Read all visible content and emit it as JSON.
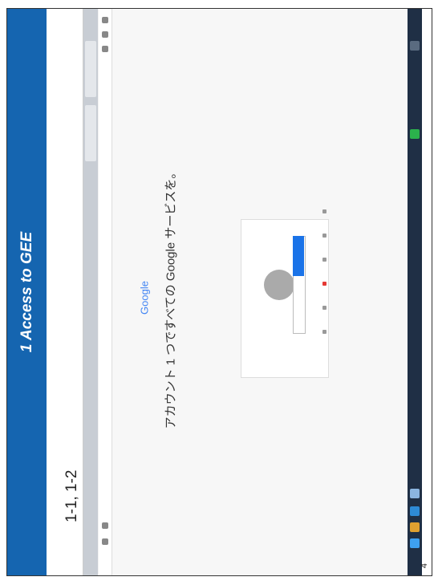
{
  "slide": {
    "title": "1 Access to GEE",
    "subtitle": "1-1, 1-2",
    "page_number": "4"
  },
  "screenshot": {
    "headline": "アカウント 1 つですべての Google サービスを。",
    "logo_text": "Google",
    "colors": {
      "title_band": "#1565b0",
      "taskbar": "#1f2f45",
      "button": "#1a73e8"
    }
  }
}
